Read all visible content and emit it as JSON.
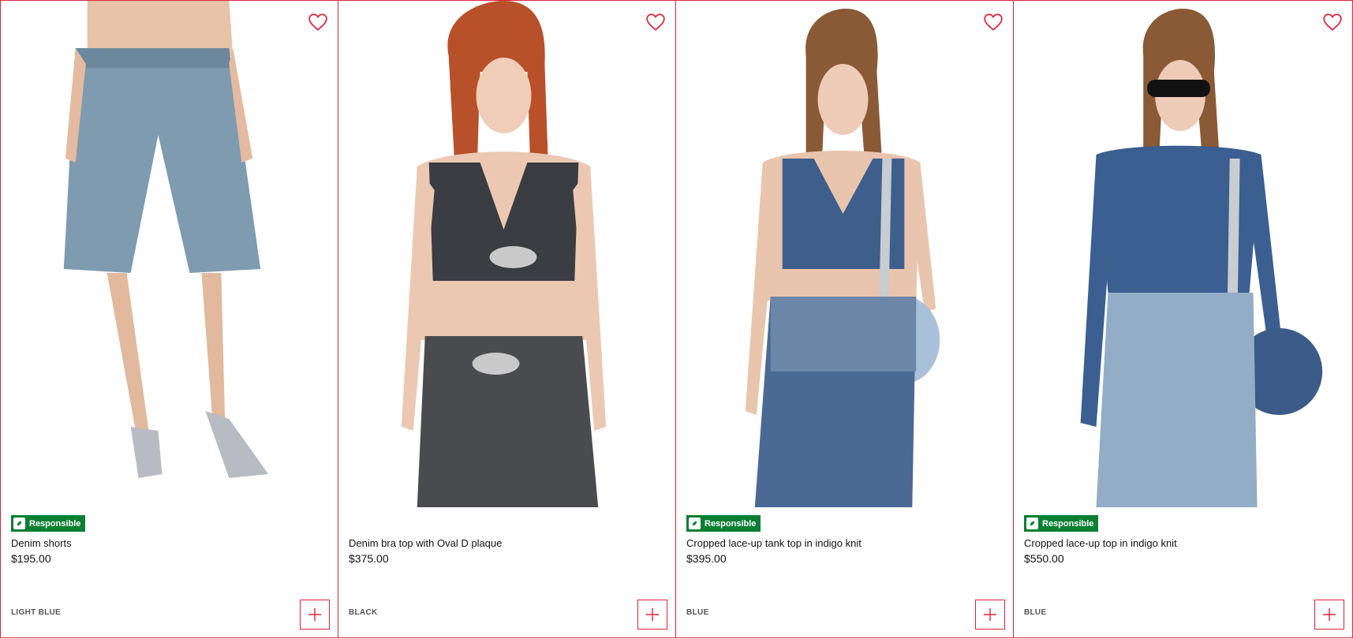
{
  "accent_color": "#e0243a",
  "badge_color": "#0a7f33",
  "products": [
    {
      "badge": "Responsible",
      "name": "Denim shorts",
      "price": "$195.00",
      "color": "LIGHT BLUE",
      "icon": "heart-icon"
    },
    {
      "badge": "",
      "name": "Denim bra top with Oval D plaque",
      "price": "$375.00",
      "color": "BLACK",
      "icon": "heart-icon"
    },
    {
      "badge": "Responsible",
      "name": "Cropped lace-up tank top in indigo knit",
      "price": "$395.00",
      "color": "BLUE",
      "icon": "heart-icon"
    },
    {
      "badge": "Responsible",
      "name": "Cropped lace-up top in indigo knit",
      "price": "$550.00",
      "color": "BLUE",
      "icon": "heart-icon"
    }
  ]
}
